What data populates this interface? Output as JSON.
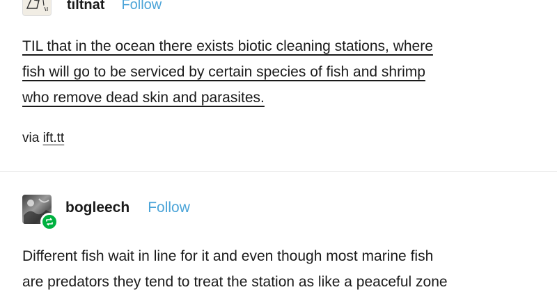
{
  "post1": {
    "username": "tiltnat",
    "follow_label": "Follow",
    "lines": [
      "TIL that in the ocean there exists biotic cleaning stations, where",
      "fish will go to be serviced by certain species of fish and shrimp",
      "who remove dead skin and parasites."
    ],
    "via_label": "via",
    "via_link": "ift.tt"
  },
  "post2": {
    "username": "bogleech",
    "follow_label": "Follow",
    "lines": [
      "Different fish wait in line for it and even though most marine fish",
      "are predators they tend to treat the station as like a peaceful zone"
    ]
  },
  "colors": {
    "follow": "#4ba4d8",
    "reblog_badge": "#00b140"
  },
  "icons": [
    "reblog-icon"
  ]
}
